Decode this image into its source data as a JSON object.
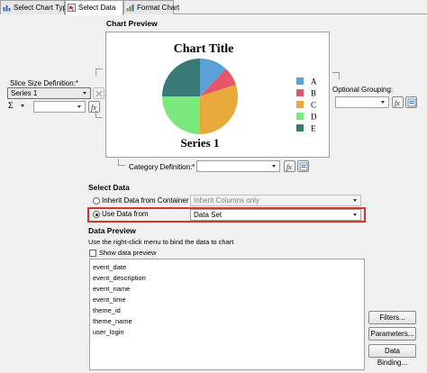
{
  "tabs": [
    {
      "label": "Select Chart Type"
    },
    {
      "label": "Select Data"
    },
    {
      "label": "Format Chart"
    }
  ],
  "chart_preview": {
    "section_title": "Chart Preview",
    "chart_title": "Chart Title",
    "series_label": "Series 1",
    "legend": [
      "A",
      "B",
      "C",
      "D",
      "E"
    ]
  },
  "colors": {
    "A": "#5aa0d8",
    "B": "#e8556a",
    "C": "#e8a93a",
    "D": "#7ae87a",
    "E": "#3a7a76"
  },
  "chart_data": {
    "type": "pie",
    "title": "Chart Title",
    "categories": [
      "A",
      "B",
      "C",
      "D",
      "E"
    ],
    "values": [
      12,
      8,
      30,
      25,
      25
    ],
    "series": [
      {
        "name": "Series 1",
        "values": [
          12,
          8,
          30,
          25,
          25
        ]
      }
    ]
  },
  "slice_size": {
    "label": "Slice Size Definition:*",
    "series_value": "Series 1",
    "sigma_symbol": "Σ",
    "aggregate_value": ""
  },
  "optional_grouping": {
    "label": "Optional Grouping:",
    "value": ""
  },
  "category_definition": {
    "label": "Category Definition:*",
    "value": ""
  },
  "select_data": {
    "section_title": "Select Data",
    "inherit_label": "Inherit Data from Container",
    "inherit_value": "Inherit Columns only",
    "use_label": "Use Data from",
    "use_value": "Data Set"
  },
  "data_preview": {
    "section_title": "Data Preview",
    "hint": "Use the right-click menu to bind the data to chart",
    "show_preview_label": "Show data preview",
    "columns": [
      "event_date",
      "event_description",
      "event_name",
      "event_time",
      "theme_id",
      "theme_name",
      "user_login"
    ]
  },
  "buttons": {
    "filters": "Filters...",
    "parameters": "Parameters...",
    "data_binding": "Data Binding..."
  }
}
